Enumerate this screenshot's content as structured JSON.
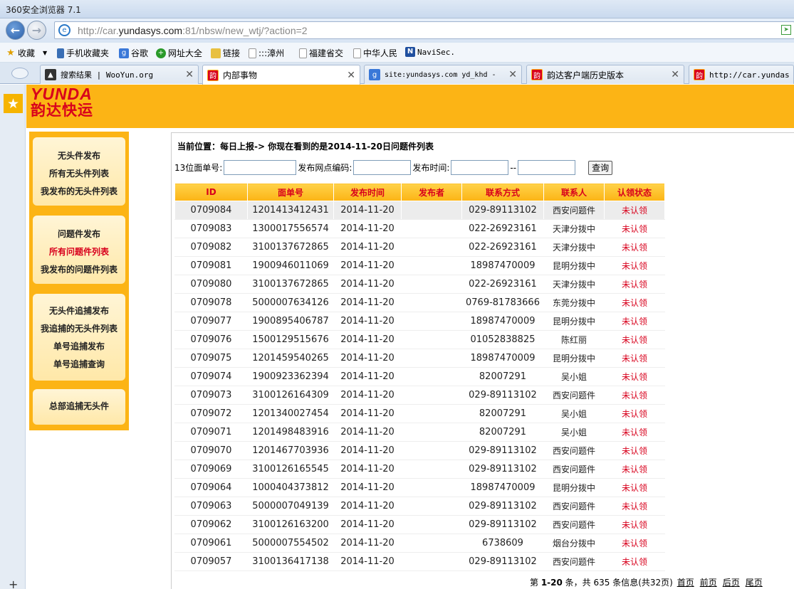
{
  "browser": {
    "title": "360安全浏览器 7.1",
    "url_prefix": "http://car.",
    "url_domain": "yundasys.com",
    "url_suffix": ":81/nbsw/new_wtj/?action=2",
    "bookmarks": [
      "收藏",
      "手机收藏夹",
      "谷歌",
      "网址大全",
      "链接",
      ":::漳州",
      "福建省交",
      "中华人民",
      "NaviSec."
    ],
    "tabs": [
      {
        "label": "搜索结果 | WooYun.org",
        "active": false
      },
      {
        "label": "内部事物",
        "active": true
      },
      {
        "label": "site:yundasys.com yd_khd - ",
        "active": false
      },
      {
        "label": "韵达客户端历史版本",
        "active": false
      },
      {
        "label": "http://car.yundasys.",
        "active": false
      }
    ]
  },
  "logo": {
    "en": "YUNDA",
    "cn": "韵达快运"
  },
  "sidebar": {
    "group1": [
      "无头件发布",
      "所有无头件列表",
      "我发布的无头件列表"
    ],
    "group2": [
      "问题件发布",
      "所有问题件列表",
      "我发布的问题件列表"
    ],
    "group3": [
      "无头件追捕发布",
      "我追捕的无头件列表",
      "单号追捕发布",
      "单号追捕查询"
    ],
    "group4": [
      "总部追捕无头件"
    ]
  },
  "breadcrumb": "当前位置：每日上报-> 你现在看到的是2014-11-20日问题件列表",
  "search": {
    "waybill_label": "13位面单号:",
    "site_label": "发布网点编码:",
    "time_label": "发布时间:",
    "range_sep": "--",
    "query_button": "查询"
  },
  "table": {
    "headers": [
      "ID",
      "面单号",
      "发布时间",
      "发布者",
      "联系方式",
      "联系人",
      "认领状态"
    ],
    "rows": [
      [
        "0709084",
        "1201413412431",
        "2014-11-20",
        "",
        "029-89113102",
        "西安问题件",
        "未认领"
      ],
      [
        "0709083",
        "1300017556574",
        "2014-11-20",
        "",
        "022-26923161",
        "天津分拨中",
        "未认领"
      ],
      [
        "0709082",
        "3100137672865",
        "2014-11-20",
        "",
        "022-26923161",
        "天津分拨中",
        "未认领"
      ],
      [
        "0709081",
        "1900946011069",
        "2014-11-20",
        "",
        "18987470009",
        "昆明分拨中",
        "未认领"
      ],
      [
        "0709080",
        "3100137672865",
        "2014-11-20",
        "",
        "022-26923161",
        "天津分拨中",
        "未认领"
      ],
      [
        "0709078",
        "5000007634126",
        "2014-11-20",
        "",
        "0769-81783666",
        "东莞分拨中",
        "未认领"
      ],
      [
        "0709077",
        "1900895406787",
        "2014-11-20",
        "",
        "18987470009",
        "昆明分拨中",
        "未认领"
      ],
      [
        "0709076",
        "1500129515676",
        "2014-11-20",
        "",
        "01052838825",
        "陈红丽",
        "未认领"
      ],
      [
        "0709075",
        "1201459540265",
        "2014-11-20",
        "",
        "18987470009",
        "昆明分拨中",
        "未认领"
      ],
      [
        "0709074",
        "1900923362394",
        "2014-11-20",
        "",
        "82007291",
        "吴小姐",
        "未认领"
      ],
      [
        "0709073",
        "3100126164309",
        "2014-11-20",
        "",
        "029-89113102",
        "西安问题件",
        "未认领"
      ],
      [
        "0709072",
        "1201340027454",
        "2014-11-20",
        "",
        "82007291",
        "吴小姐",
        "未认领"
      ],
      [
        "0709071",
        "1201498483916",
        "2014-11-20",
        "",
        "82007291",
        "吴小姐",
        "未认领"
      ],
      [
        "0709070",
        "1201467703936",
        "2014-11-20",
        "",
        "029-89113102",
        "西安问题件",
        "未认领"
      ],
      [
        "0709069",
        "3100126165545",
        "2014-11-20",
        "",
        "029-89113102",
        "西安问题件",
        "未认领"
      ],
      [
        "0709064",
        "1000404373812",
        "2014-11-20",
        "",
        "18987470009",
        "昆明分拨中",
        "未认领"
      ],
      [
        "0709063",
        "5000007049139",
        "2014-11-20",
        "",
        "029-89113102",
        "西安问题件",
        "未认领"
      ],
      [
        "0709062",
        "3100126163200",
        "2014-11-20",
        "",
        "029-89113102",
        "西安问题件",
        "未认领"
      ],
      [
        "0709061",
        "5000007554502",
        "2014-11-20",
        "",
        "6738609",
        "烟台分拨中",
        "未认领"
      ],
      [
        "0709057",
        "3100136417138",
        "2014-11-20",
        "",
        "029-89113102",
        "西安问题件",
        "未认领"
      ]
    ]
  },
  "pager": {
    "prefix": "第 ",
    "range": "1-20",
    "middle": " 条，共 ",
    "total": "635",
    "suffix": " 条信息(共32页)",
    "first": "首页",
    "prev": "前页",
    "next": "后页",
    "last": "尾页"
  },
  "colors": {
    "brand_yellow": "#fcb415",
    "brand_red": "#d8001c"
  }
}
